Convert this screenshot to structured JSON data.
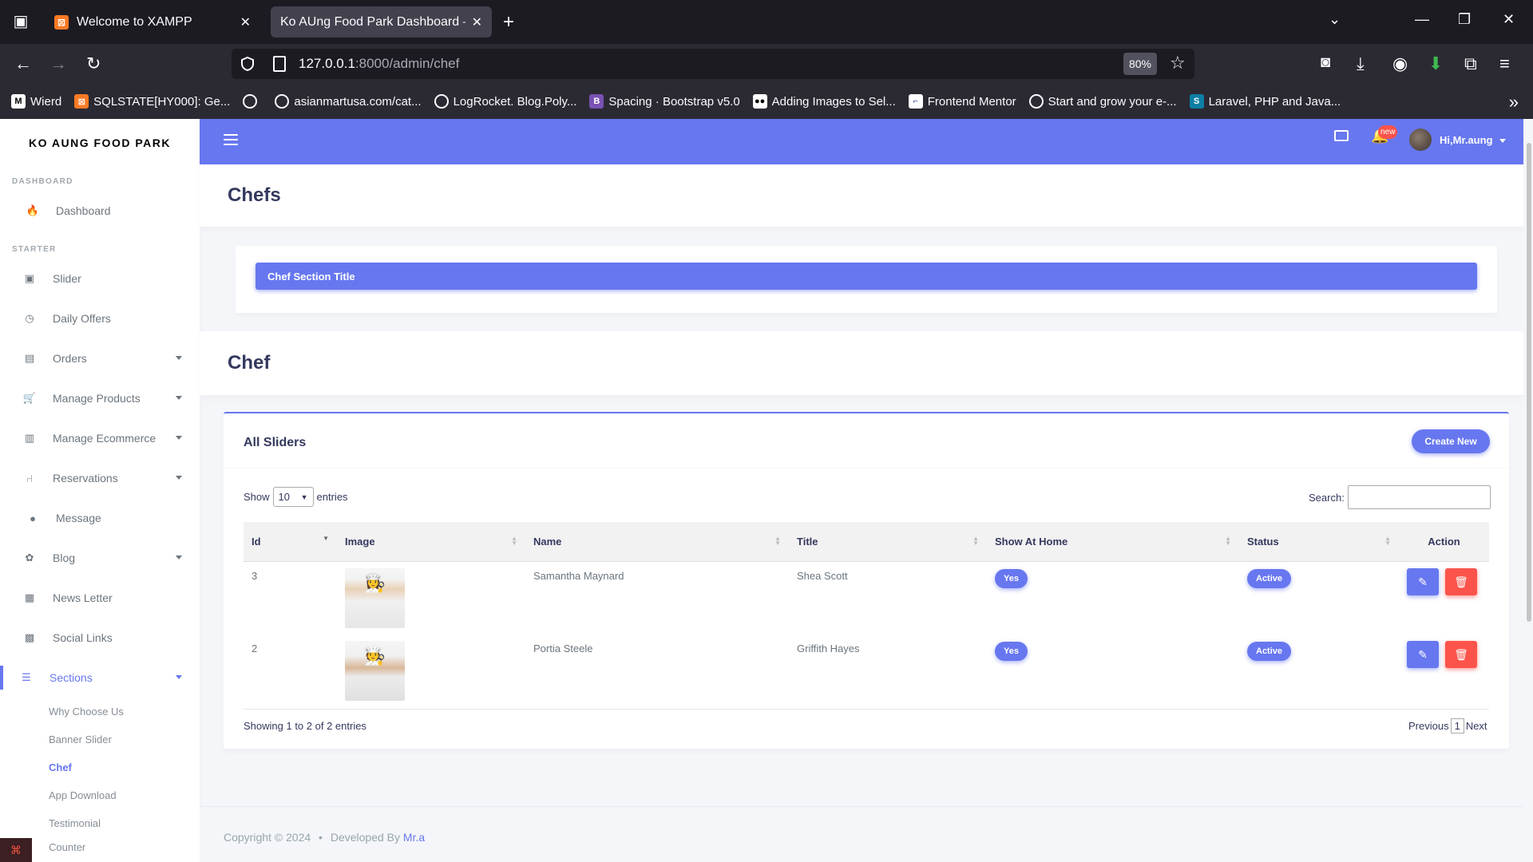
{
  "browser": {
    "tabs": [
      {
        "label": "Welcome to XAMPP",
        "active": false
      },
      {
        "label": "Ko AUng Food Park Dashboard — S",
        "active": true
      }
    ],
    "url_host": "127.0.0.1",
    "url_rest": ":8000/admin/chef",
    "zoom": "80%",
    "bookmarks": [
      {
        "label": "Wierd",
        "icon": "medium-icon"
      },
      {
        "label": "SQLSTATE[HY000]: Ge...",
        "icon": "xampp-icon"
      },
      {
        "label": "",
        "icon": "globe-icon"
      },
      {
        "label": "asianmartusa.com/cat...",
        "icon": "globe-icon"
      },
      {
        "label": "LogRocket. Blog.Poly...",
        "icon": "globe-icon"
      },
      {
        "label": "Spacing · Bootstrap v5.0",
        "icon": "bootstrap-icon"
      },
      {
        "label": "Adding Images to Sel...",
        "icon": "medium-icon"
      },
      {
        "label": "Frontend Mentor",
        "icon": "frontend-mentor-icon"
      },
      {
        "label": "Start and grow your e-...",
        "icon": "globe-icon"
      },
      {
        "label": "Laravel, PHP and Java...",
        "icon": "s-icon"
      }
    ]
  },
  "sidebar": {
    "brand": "KO AUNG FOOD PARK",
    "header_dashboard": "DASHBOARD",
    "header_starter": "STARTER",
    "dashboard": "Dashboard",
    "items": [
      {
        "label": "Slider",
        "icon": "image-icon",
        "dropdown": false
      },
      {
        "label": "Daily Offers",
        "icon": "clock-icon",
        "dropdown": false
      },
      {
        "label": "Orders",
        "icon": "box-icon",
        "dropdown": true
      },
      {
        "label": "Manage Products",
        "icon": "cart-icon",
        "dropdown": true
      },
      {
        "label": "Manage Ecommerce",
        "icon": "store-icon",
        "dropdown": true
      },
      {
        "label": "Reservations",
        "icon": "chair-icon",
        "dropdown": true
      },
      {
        "label": "Message",
        "icon": "chat-icon",
        "dropdown": false
      },
      {
        "label": "Blog",
        "icon": "palette-icon",
        "dropdown": true
      },
      {
        "label": "News Letter",
        "icon": "newspaper-icon",
        "dropdown": false
      },
      {
        "label": "Social Links",
        "icon": "share-icon",
        "dropdown": false
      },
      {
        "label": "Sections",
        "icon": "list-icon",
        "dropdown": true
      }
    ],
    "sub_items": [
      "Why Choose Us",
      "Banner Slider",
      "Chef",
      "App Download",
      "Testimonial",
      "Counter"
    ]
  },
  "topnav": {
    "badge": "new",
    "user": "Hi,Mr.aung"
  },
  "page": {
    "title1": "Chefs",
    "collapse_title": "Chef Section Title",
    "title2": "Chef"
  },
  "card": {
    "title": "All Sliders",
    "create_button": "Create New",
    "show_label": "Show",
    "entries_value": "10",
    "entries_label": "entries",
    "search_label": "Search:",
    "columns": [
      "Id",
      "Image",
      "Name",
      "Title",
      "Show At Home",
      "Status",
      "Action"
    ],
    "rows": [
      {
        "id": "3",
        "name": "Samantha Maynard",
        "title": "Shea Scott",
        "show_at_home": "Yes",
        "status": "Active"
      },
      {
        "id": "2",
        "name": "Portia Steele",
        "title": "Griffith Hayes",
        "show_at_home": "Yes",
        "status": "Active"
      }
    ],
    "info": "Showing 1 to 2 of 2 entries",
    "prev": "Previous",
    "page": "1",
    "next": "Next"
  },
  "footer": {
    "copyright": "Copyright © 2024",
    "dot": "•",
    "developed_by": "Developed By",
    "author": "Mr.a"
  },
  "colors": {
    "primary": "#6777ef",
    "danger": "#fc544b",
    "browser_dark": "#1c1b22"
  }
}
